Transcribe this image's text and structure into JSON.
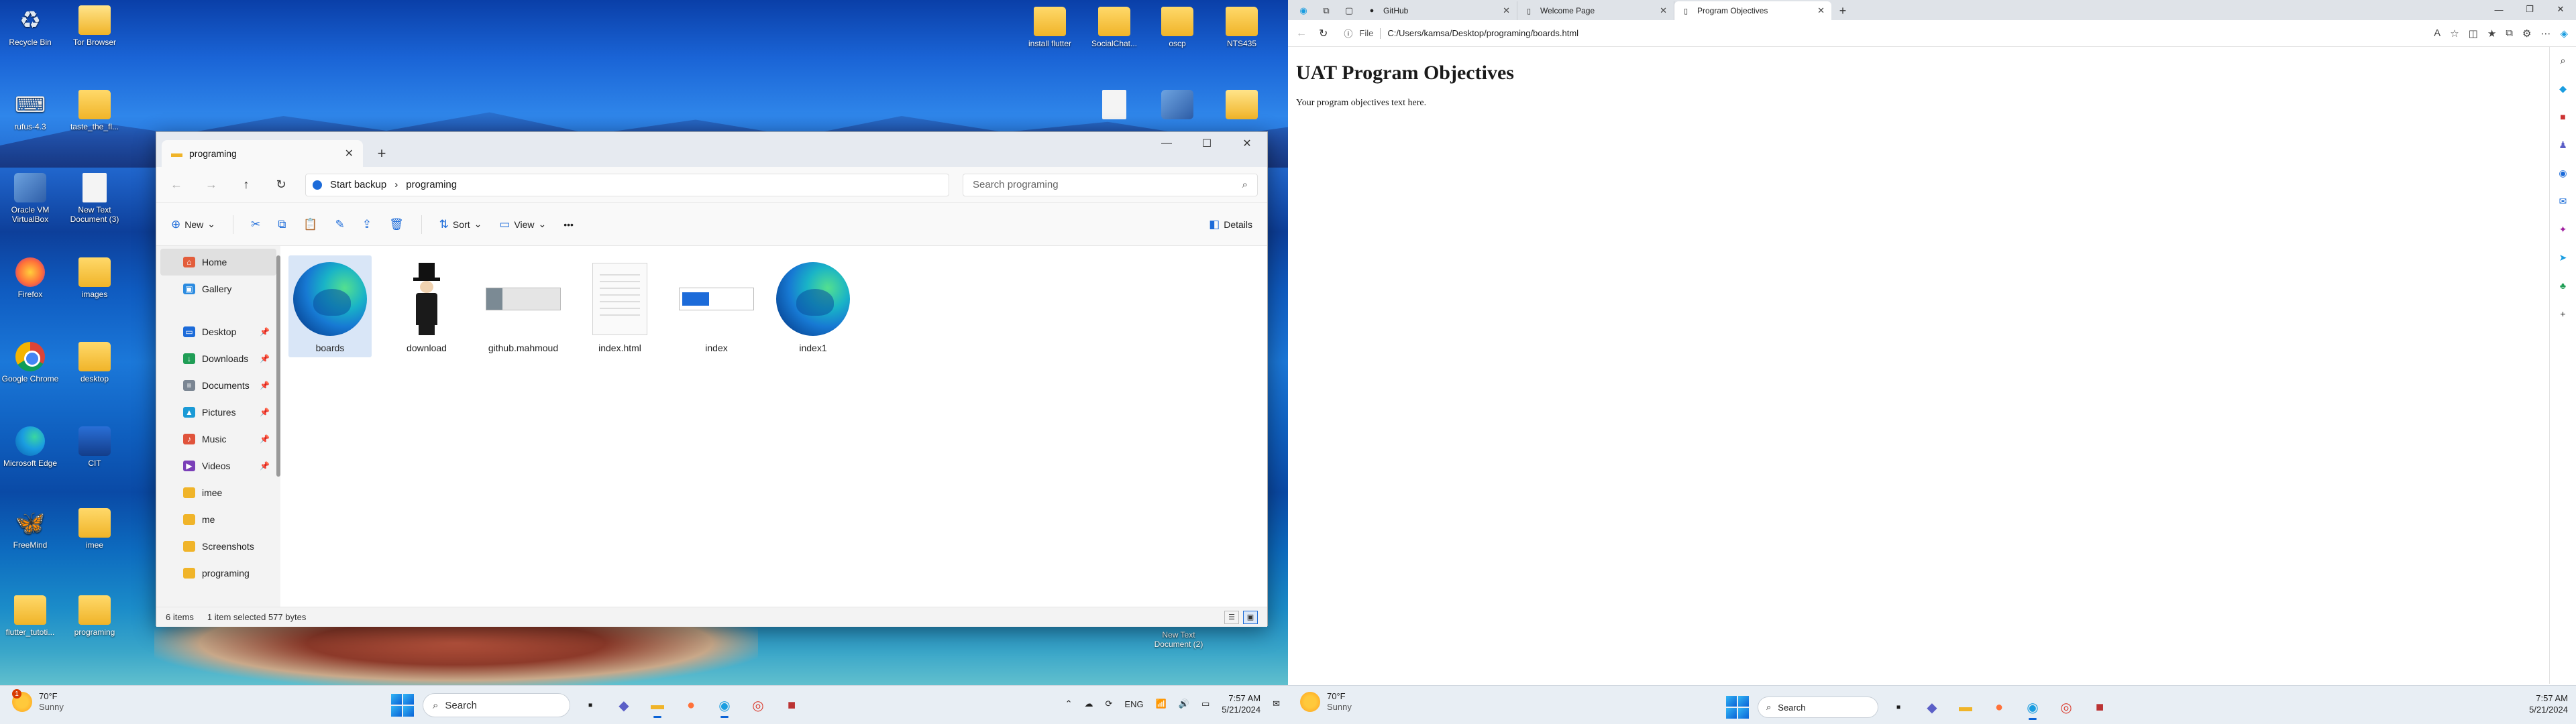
{
  "desktop": {
    "left_icons": [
      {
        "label": "Recycle Bin",
        "icon": "recycle-bin-icon"
      },
      {
        "label": "Tor Browser",
        "icon": "tor-browser-icon"
      },
      {
        "label": "rufus-4.3",
        "icon": "usb-drive-icon"
      },
      {
        "label": "taste_the_fl...",
        "icon": "folder-icon"
      },
      {
        "label": "Oracle VM VirtualBox",
        "icon": "virtualbox-icon"
      },
      {
        "label": "New Text Document (3)",
        "icon": "text-file-icon"
      },
      {
        "label": "Firefox",
        "icon": "firefox-icon"
      },
      {
        "label": "images",
        "icon": "folder-icon"
      },
      {
        "label": "Google Chrome",
        "icon": "chrome-icon"
      },
      {
        "label": "desktop",
        "icon": "folder-icon"
      },
      {
        "label": "Microsoft Edge",
        "icon": "edge-icon"
      },
      {
        "label": "CIT",
        "icon": "cisco-icon"
      },
      {
        "label": "FreeMind",
        "icon": "freemind-icon"
      },
      {
        "label": "imee",
        "icon": "folder-icon"
      },
      {
        "label": "flutter_tutoti...",
        "icon": "folder-icon"
      },
      {
        "label": "programing",
        "icon": "folder-icon"
      }
    ],
    "top_right_icons": [
      {
        "label": "install flutter",
        "icon": "folder-icon"
      },
      {
        "label": "SocialChat...",
        "icon": "folder-icon"
      },
      {
        "label": "oscp",
        "icon": "folder-icon"
      },
      {
        "label": "NTS435",
        "icon": "folder-icon"
      }
    ],
    "bottom_right_icon": {
      "label": "New Text Document (2)",
      "icon": "text-file-icon"
    }
  },
  "explorer": {
    "tab_title": "programing",
    "address": {
      "backup_label": "Start backup",
      "path": "programing",
      "search_placeholder": "Search programing"
    },
    "toolbar": {
      "new_label": "New",
      "sort_label": "Sort",
      "view_label": "View",
      "more_label": "•••",
      "details_label": "Details"
    },
    "nav": [
      {
        "label": "Home",
        "icon": "home-icon",
        "color": "#e35d3b"
      },
      {
        "label": "Gallery",
        "icon": "gallery-icon",
        "color": "#2b8be0"
      },
      {
        "label": "Desktop",
        "icon": "desktop-icon",
        "color": "#1c6bd9",
        "pinned": true
      },
      {
        "label": "Downloads",
        "icon": "download-icon",
        "color": "#1f9d55",
        "pinned": true
      },
      {
        "label": "Documents",
        "icon": "documents-icon",
        "color": "#7a8592",
        "pinned": true
      },
      {
        "label": "Pictures",
        "icon": "pictures-icon",
        "color": "#1a9ad6",
        "pinned": true
      },
      {
        "label": "Music",
        "icon": "music-icon",
        "color": "#e0533b",
        "pinned": true
      },
      {
        "label": "Videos",
        "icon": "videos-icon",
        "color": "#7a3fb8",
        "pinned": true
      },
      {
        "label": "imee",
        "icon": "folder-icon",
        "color": "#f0b429"
      },
      {
        "label": "me",
        "icon": "folder-icon",
        "color": "#f0b429"
      },
      {
        "label": "Screenshots",
        "icon": "folder-icon",
        "color": "#f0b429"
      },
      {
        "label": "programing",
        "icon": "folder-icon",
        "color": "#f0b429"
      }
    ],
    "files": [
      {
        "name": "boards",
        "thumb": "edge-html-icon",
        "selected": true
      },
      {
        "name": "download",
        "thumb": "image-thumbnail"
      },
      {
        "name": "github.mahmoud",
        "thumb": "screenshot-thumbnail"
      },
      {
        "name": "index.html",
        "thumb": "document-icon"
      },
      {
        "name": "index",
        "thumb": "html-thumbnail"
      },
      {
        "name": "index1",
        "thumb": "edge-html-icon"
      }
    ],
    "status": {
      "items": "6 items",
      "selection": "1 item selected  577 bytes"
    }
  },
  "taskbar_left": {
    "weather_temp": "70°F",
    "weather_desc": "Sunny",
    "weather_badge": "1",
    "search_label": "Search",
    "lang": "ENG",
    "time": "7:57 AM",
    "date": "5/21/2024"
  },
  "browser": {
    "tabs": [
      {
        "title": "GitHub",
        "icon": "github-icon"
      },
      {
        "title": "Welcome Page",
        "icon": "page-icon"
      },
      {
        "title": "Program Objectives",
        "icon": "page-icon",
        "active": true
      }
    ],
    "url_scheme": "File",
    "url": "C:/Users/kamsa/Desktop/programing/boards.html",
    "page": {
      "heading": "UAT Program Objectives",
      "body": "Your program objectives text here."
    }
  },
  "taskbar_right": {
    "weather_temp": "70°F",
    "weather_desc": "Sunny",
    "search_label": "Search",
    "time": "7:57 AM",
    "date": "5/21/2024"
  },
  "colors": {
    "accent": "#1c6bd9",
    "selection": "#d9e6f7",
    "taskbar": "#e8eef4"
  }
}
